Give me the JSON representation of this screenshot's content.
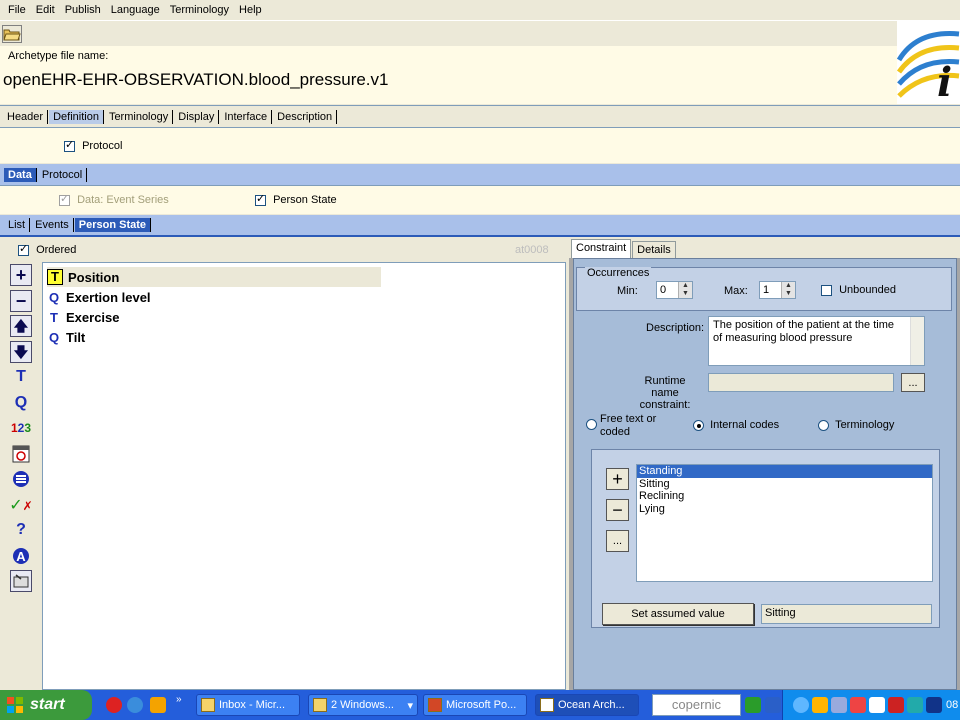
{
  "menu": [
    "File",
    "Edit",
    "Publish",
    "Language",
    "Terminology",
    "Help"
  ],
  "archetype": {
    "label": "Archetype file name:",
    "value": "openEHR-EHR-OBSERVATION.blood_pressure.v1"
  },
  "main_tabs": [
    "Header",
    "Definition",
    "Terminology",
    "Display",
    "Interface",
    "Description"
  ],
  "main_tab_selected": "Definition",
  "protocol_checkbox": {
    "label": "Protocol",
    "checked": true
  },
  "sub_tabs": [
    "Data",
    "Protocol"
  ],
  "data_area": {
    "event_series": "Data: Event Series",
    "person_state": "Person State"
  },
  "state_tabs": [
    "List",
    "Events",
    "Person State"
  ],
  "left": {
    "ordered": "Ordered",
    "at_code": "at0008",
    "tools": [
      "plus-icon",
      "minus-icon",
      "arrow-up-icon",
      "arrow-down-icon",
      "text-icon",
      "quantity-icon",
      "count-icon",
      "datetime-icon",
      "ordinal-icon",
      "boolean-icon",
      "question-icon",
      "slot-icon",
      "cluster-icon"
    ],
    "tree": [
      {
        "icon": "T",
        "label": "Position",
        "selected": true
      },
      {
        "icon": "Q",
        "label": "Exertion level"
      },
      {
        "icon": "T",
        "label": "Exercise"
      },
      {
        "icon": "Q",
        "label": "Tilt"
      }
    ]
  },
  "right": {
    "tabs": [
      "Constraint",
      "Details"
    ],
    "occurrences": {
      "title": "Occurrences",
      "min_label": "Min:",
      "min": "0",
      "max_label": "Max:",
      "max": "1",
      "unbounded": "Unbounded"
    },
    "description_label": "Description:",
    "description": "The position of the patient at the time of measuring blood pressure",
    "runtime_label_1": "Runtime name",
    "runtime_label_2": "constraint:",
    "runtime_button": "...",
    "radios": {
      "free_1": "Free text or",
      "free_2": "coded",
      "internal": "Internal codes",
      "terminology": "Terminology"
    },
    "codes": [
      "Standing",
      "Sitting",
      "Reclining",
      "Lying"
    ],
    "code_buttons": {
      "add": "+",
      "remove": "−",
      "more": "..."
    },
    "assumed_button": "Set assumed value",
    "assumed_value": "Sitting"
  },
  "taskbar": {
    "start": "start",
    "items": [
      "Inbox - Micr...",
      "2 Windows...",
      "Microsoft Po...",
      "Ocean Arch..."
    ],
    "search": "copernic",
    "clock": "08"
  }
}
